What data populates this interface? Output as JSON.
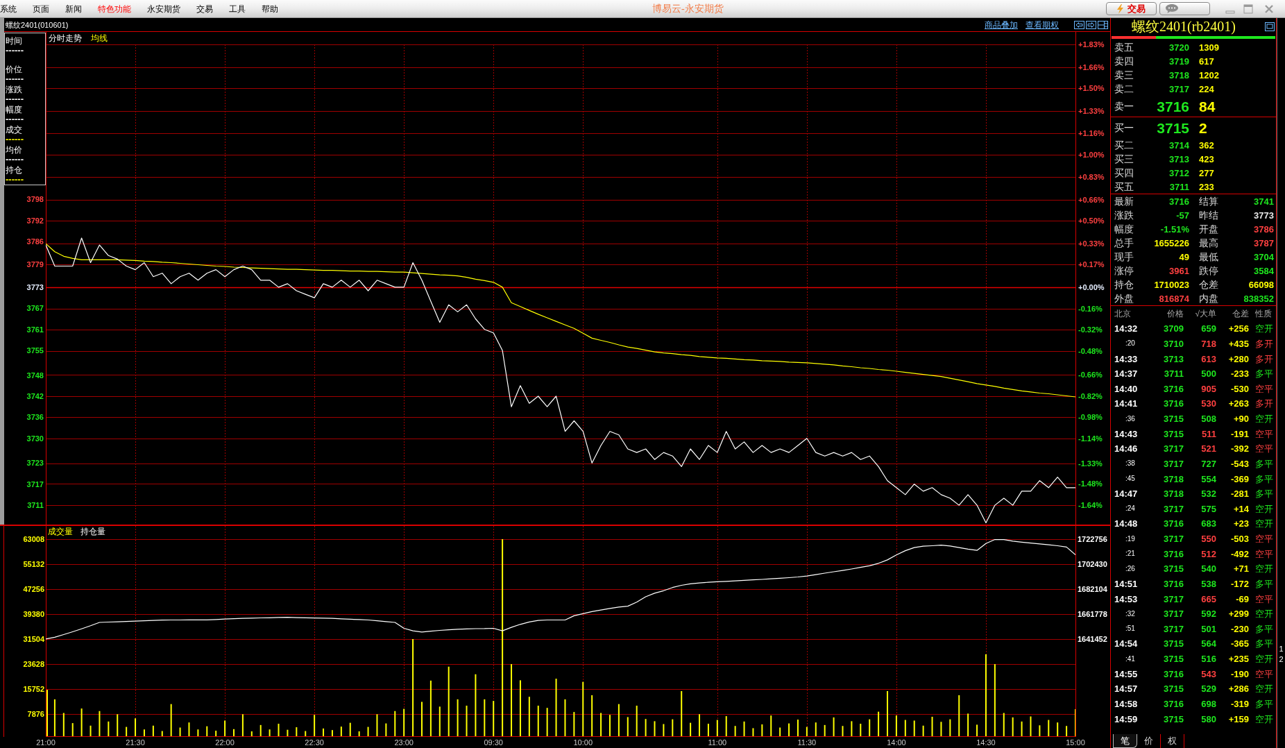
{
  "menu_bar": {
    "items": [
      {
        "label": "系统",
        "highlighted": false
      },
      {
        "label": "页面",
        "highlighted": false
      },
      {
        "label": "新闻",
        "highlighted": false
      },
      {
        "label": "特色功能",
        "highlighted": true
      },
      {
        "label": "永安期货",
        "highlighted": false
      },
      {
        "label": "交易",
        "highlighted": false
      },
      {
        "label": "工具",
        "highlighted": false
      },
      {
        "label": "帮助",
        "highlighted": false
      }
    ],
    "title": "博易云-永安期货",
    "trade_button": {
      "label": "交易"
    }
  },
  "contract_bar": {
    "title": "螺纹2401(010601)",
    "links": [
      "商品叠加",
      "查看期权"
    ]
  },
  "info_box": {
    "items": [
      {
        "label": "时间",
        "value": "------",
        "color": "#ffffff"
      },
      {
        "label": "价位",
        "value": "------",
        "color": "#ffffff"
      },
      {
        "label": "涨跌",
        "value": "------",
        "color": "#ffffff"
      },
      {
        "label": "幅度",
        "value": "------",
        "color": "#ffffff"
      },
      {
        "label": "成交",
        "value": "------",
        "color": "#ffff00"
      },
      {
        "label": "均价",
        "value": "------",
        "color": "#ffffff"
      },
      {
        "label": "持仓",
        "value": "------",
        "color": "#ffff00"
      }
    ]
  },
  "price_chart": {
    "chart_data": {
      "type": "line",
      "grid": true,
      "categories": [
        null,
        null,
        null,
        null,
        null,
        null,
        null,
        null,
        null,
        null,
        null,
        null,
        null,
        null,
        null,
        null,
        null,
        null,
        null,
        null,
        null,
        null,
        null,
        null,
        null,
        null,
        null,
        null,
        null,
        null,
        null,
        null,
        null,
        null,
        null,
        null,
        null,
        null,
        null,
        null,
        null,
        null,
        null,
        null,
        null,
        null,
        null,
        null,
        null,
        null,
        null,
        null,
        null,
        null,
        null,
        null,
        null,
        null,
        null,
        null,
        null,
        null,
        null,
        null,
        null,
        null,
        null,
        null,
        null,
        null,
        null,
        null,
        null,
        null,
        null,
        null,
        null,
        null,
        null,
        null,
        null,
        null,
        null,
        null,
        null,
        null,
        null,
        null,
        null,
        null,
        null,
        null,
        null,
        null,
        null,
        null,
        null,
        null,
        null,
        null,
        null,
        null,
        null,
        null,
        null,
        null,
        null,
        null,
        null,
        null,
        null,
        null,
        null,
        null,
        null,
        null
      ],
      "ylim": [
        3705.5,
        3842.05
      ],
      "y2lim": [
        -1.789,
        1.83
      ],
      "ref_lines": [
        {
          "axis": "y",
          "value": 3773
        }
      ],
      "yticks": [
        3798,
        3792,
        3786,
        {
          "value": 3779.4,
          "label": "3779"
        },
        3773,
        3767,
        3761,
        3755,
        3748,
        3742,
        3736,
        3730,
        3723,
        3717,
        3711
      ],
      "y2ticks": [
        {
          "value": 1.83,
          "label": "+1.83%"
        },
        {
          "value": 1.66,
          "label": "+1.66%"
        },
        {
          "value": 1.5,
          "label": "+1.50%"
        },
        {
          "value": 1.33,
          "label": "+1.33%"
        },
        {
          "value": 1.16,
          "label": "+1.16%"
        },
        {
          "value": 1.0,
          "label": "+1.00%"
        },
        {
          "value": 0.83,
          "label": "+0.83%"
        },
        {
          "value": 0.66,
          "label": "+0.66%"
        },
        {
          "value": 0.5,
          "label": "+0.50%"
        },
        {
          "value": 0.33,
          "label": "+0.33%"
        },
        {
          "value": 0.17,
          "label": "+0.17%"
        },
        {
          "value": 0,
          "label": "+0.00%"
        },
        {
          "value": -0.16,
          "label": "-0.16%"
        },
        {
          "value": -0.32,
          "label": "-0.32%"
        },
        {
          "value": -0.48,
          "label": "-0.48%"
        },
        {
          "value": -0.66,
          "label": "-0.66%"
        },
        {
          "value": -0.82,
          "label": "-0.82%"
        },
        {
          "value": -0.98,
          "label": "-0.98%"
        },
        {
          "value": -1.14,
          "label": "-1.14%"
        },
        {
          "value": -1.33,
          "label": "-1.33%"
        },
        {
          "value": -1.48,
          "label": "-1.48%"
        },
        {
          "value": -1.64,
          "label": "-1.64%"
        }
      ],
      "series": [
        {
          "name": "分时走势",
          "color": "#ffffff",
          "values": [
            3785,
            3779,
            3779,
            3779,
            3787,
            3780,
            3785,
            3782,
            3781,
            3779,
            3778,
            3780,
            3776,
            3777,
            3774,
            3776,
            3777,
            3775,
            3777,
            3778,
            3776,
            3778,
            3779,
            3778,
            3775,
            3775,
            3773,
            3774,
            3772,
            3771,
            3770,
            3774,
            3773,
            3775,
            3773,
            3775,
            3772,
            3775,
            3774,
            3773,
            3773,
            3780,
            3775,
            3769,
            3763,
            3768,
            3766,
            3768,
            3764,
            3761,
            3760,
            3755,
            3739,
            3745,
            3740,
            3742,
            3739,
            3742,
            3732,
            3735,
            3732,
            3723,
            3728,
            3732,
            3731,
            3727,
            3726,
            3727,
            3724,
            3726,
            3725,
            3722,
            3727,
            3724,
            3728,
            3726,
            3732,
            3727,
            3729,
            3726,
            3728,
            3726,
            3727,
            3726,
            3728,
            3730,
            3726,
            3725,
            3726,
            3725,
            3726,
            3724,
            3725,
            3722,
            3718,
            3716,
            3714,
            3717,
            3715,
            3716,
            3714,
            3713,
            3711,
            3714,
            3711,
            3706,
            3711,
            3713,
            3711,
            3715,
            3715,
            3718,
            3716,
            3719,
            3716,
            3716
          ]
        },
        {
          "name": "均线",
          "color": "#ffff00",
          "values": [
            3785.4,
            3783.1,
            3781.8,
            3781.2,
            3780.8,
            3780.8,
            3780.8,
            3780.8,
            3780.8,
            3780.7,
            3780.6,
            3780.4,
            3780.3,
            3780.1,
            3780.0,
            3779.8,
            3779.6,
            3779.4,
            3779.2,
            3779.0,
            3778.9,
            3778.7,
            3778.6,
            3778.5,
            3778.4,
            3778.3,
            3778.2,
            3778.1,
            3778.1,
            3778.0,
            3777.9,
            3777.8,
            3777.8,
            3777.7,
            3777.6,
            3777.6,
            3777.5,
            3777.5,
            3777.4,
            3777.3,
            3777.3,
            3777.1,
            3776.9,
            3776.7,
            3776.5,
            3776.4,
            3776.2,
            3775.8,
            3775.3,
            3774.9,
            3774.4,
            3773.0,
            3768.6,
            3767.5,
            3766.4,
            3765.3,
            3764.3,
            3763.3,
            3762.3,
            3761.3,
            3759.9,
            3758.5,
            3757.9,
            3757.3,
            3756.6,
            3756.0,
            3755.6,
            3755.1,
            3754.6,
            3754.3,
            3754.1,
            3753.8,
            3753.6,
            3753.3,
            3753.1,
            3752.9,
            3752.8,
            3752.6,
            3752.4,
            3752.3,
            3752.1,
            3752.0,
            3751.9,
            3751.7,
            3751.6,
            3751.5,
            3751.3,
            3751.1,
            3750.9,
            3750.6,
            3750.4,
            3750.1,
            3749.9,
            3749.6,
            3749.4,
            3749.1,
            3748.8,
            3748.5,
            3748.2,
            3747.9,
            3747.6,
            3747.1,
            3746.6,
            3746.1,
            3745.6,
            3745.2,
            3744.8,
            3744.3,
            3743.9,
            3743.5,
            3743.2,
            3742.9,
            3742.7,
            3742.4,
            3742.1,
            3741.8
          ]
        }
      ]
    }
  },
  "volume_chart": {
    "chart_data": {
      "type": "bar",
      "grid": true,
      "categories": [
        "21:00",
        null,
        null,
        null,
        null,
        null,
        null,
        null,
        null,
        null,
        "21:30",
        null,
        null,
        null,
        null,
        null,
        null,
        null,
        null,
        null,
        "22:00",
        null,
        null,
        null,
        null,
        null,
        null,
        null,
        null,
        null,
        "22:30",
        null,
        null,
        null,
        null,
        null,
        null,
        null,
        null,
        null,
        "23:00",
        null,
        null,
        null,
        null,
        null,
        null,
        null,
        null,
        null,
        "09:30",
        null,
        null,
        null,
        null,
        null,
        null,
        null,
        null,
        null,
        "10:00",
        null,
        null,
        null,
        null,
        null,
        null,
        null,
        null,
        null,
        null,
        null,
        null,
        null,
        null,
        "11:00",
        null,
        null,
        null,
        null,
        null,
        null,
        null,
        null,
        null,
        "11:30",
        null,
        null,
        null,
        null,
        null,
        null,
        null,
        null,
        null,
        "14:00",
        null,
        null,
        null,
        null,
        null,
        null,
        null,
        null,
        null,
        "14:30",
        null,
        null,
        null,
        null,
        null,
        null,
        null,
        null,
        null,
        "15:00"
      ],
      "ylim": [
        650,
        67160
      ],
      "yticks": [
        63008,
        55132,
        47256,
        39380,
        31504,
        23628,
        15752,
        7876
      ],
      "series": [
        {
          "name": "成交量",
          "color": "#ffff00",
          "values": [
            15500,
            12500,
            8200,
            5000,
            9600,
            4200,
            8800,
            5500,
            7800,
            3800,
            6500,
            3000,
            4200,
            2500,
            11000,
            3600,
            5200,
            3000,
            4000,
            2600,
            5800,
            3100,
            7800,
            2400,
            4400,
            3000,
            4800,
            2900,
            3700,
            2500,
            7600,
            3300,
            2800,
            3900,
            5100,
            2400,
            3800,
            7800,
            4900,
            8800,
            9500,
            31500,
            11700,
            18400,
            10200,
            22800,
            12500,
            10500,
            20400,
            12500,
            12000,
            63000,
            23600,
            18500,
            13300,
            10500,
            9800,
            19000,
            12500,
            8500,
            18000,
            13800,
            8200,
            7600,
            11000,
            6900,
            10500,
            6300,
            5600,
            4700,
            6200,
            15100,
            5100,
            7800,
            4800,
            6000,
            7200,
            4100,
            5500,
            3400,
            4600,
            7400,
            3600,
            4900,
            6100,
            3800,
            5200,
            4400,
            6800,
            4100,
            5600,
            4800,
            6200,
            8600,
            15100,
            7400,
            6000,
            5800,
            4200,
            7000,
            5400,
            6200,
            13800,
            8000,
            4500,
            26700,
            23600,
            8200,
            6800,
            5500,
            7100,
            4300,
            6000,
            5200,
            4100,
            9400
          ]
        }
      ]
    }
  },
  "open_interest_chart": {
    "chart_data": {
      "type": "line",
      "categories": [
        null,
        null,
        null,
        null,
        null,
        null,
        null,
        null,
        null,
        null,
        null,
        null,
        null,
        null,
        null,
        null,
        null,
        null,
        null,
        null,
        null,
        null,
        null,
        null,
        null,
        null,
        null,
        null,
        null,
        null,
        null,
        null,
        null,
        null,
        null,
        null,
        null,
        null,
        null,
        null,
        null,
        null,
        null,
        null,
        null,
        null,
        null,
        null,
        null,
        null,
        null,
        null,
        null,
        null,
        null,
        null,
        null,
        null,
        null,
        null,
        null,
        null,
        null,
        null,
        null,
        null,
        null,
        null,
        null,
        null,
        null,
        null,
        null,
        null,
        null,
        null,
        null,
        null,
        null,
        null,
        null,
        null,
        null,
        null,
        null,
        null,
        null,
        null,
        null,
        null,
        null,
        null,
        null,
        null,
        null,
        null,
        null,
        null,
        null,
        null,
        null,
        null,
        null,
        null,
        null,
        null,
        null,
        null,
        null,
        null,
        null,
        null,
        null,
        null,
        null,
        null
      ],
      "ylim": [
        1561845,
        1733483
      ],
      "yticks": [
        1722756,
        1702430,
        1682104,
        1661778,
        1641452
      ],
      "series": [
        {
          "name": "持仓量",
          "color": "#ffffff",
          "values": [
            1641500,
            1643000,
            1645100,
            1647400,
            1649800,
            1652300,
            1655000,
            1655300,
            1655500,
            1655800,
            1656100,
            1656300,
            1656600,
            1656900,
            1657000,
            1657000,
            1657100,
            1657100,
            1657100,
            1657400,
            1657700,
            1658000,
            1658300,
            1658500,
            1658700,
            1658800,
            1659000,
            1659100,
            1658900,
            1658800,
            1658600,
            1658500,
            1658300,
            1657900,
            1657600,
            1657300,
            1657000,
            1656300,
            1655700,
            1655000,
            1650200,
            1648200,
            1647200,
            1647900,
            1648500,
            1649000,
            1649400,
            1649700,
            1649900,
            1650000,
            1650200,
            1648200,
            1651000,
            1653400,
            1655400,
            1656600,
            1657000,
            1657000,
            1657000,
            1660400,
            1662100,
            1663800,
            1665100,
            1666400,
            1667500,
            1668200,
            1671500,
            1675900,
            1678800,
            1680800,
            1683400,
            1685200,
            1686400,
            1687100,
            1687700,
            1688100,
            1688400,
            1688800,
            1689200,
            1689600,
            1690000,
            1690500,
            1690900,
            1691400,
            1692000,
            1692700,
            1693900,
            1695100,
            1696200,
            1697300,
            1698500,
            1699800,
            1701100,
            1703100,
            1705900,
            1709900,
            1713400,
            1715900,
            1717000,
            1717400,
            1717900,
            1717200,
            1715900,
            1714600,
            1713600,
            1719200,
            1722500,
            1722400,
            1721200,
            1720300,
            1719600,
            1718900,
            1718200,
            1717400,
            1716300,
            1710000
          ]
        }
      ]
    }
  },
  "quote_panel": {
    "title": "螺纹2401(rb2401)",
    "ratio_bar": {
      "level": 0.27
    },
    "asks": [
      {
        "label": "卖五",
        "price": "3720",
        "volume": "1309",
        "kind": "level"
      },
      {
        "label": "卖四",
        "price": "3719",
        "volume": "617",
        "kind": "level"
      },
      {
        "label": "卖三",
        "price": "3718",
        "volume": "1202",
        "kind": "level"
      },
      {
        "label": "卖二",
        "price": "3717",
        "volume": "224",
        "kind": "level"
      },
      {
        "label": "卖一",
        "price": "3716",
        "volume": "84",
        "kind": "best"
      }
    ],
    "bids": [
      {
        "label": "买一",
        "price": "3715",
        "volume": "2",
        "kind": "best"
      },
      {
        "label": "买二",
        "price": "3714",
        "volume": "362",
        "kind": "level"
      },
      {
        "label": "买三",
        "price": "3713",
        "volume": "423",
        "kind": "level"
      },
      {
        "label": "买四",
        "price": "3712",
        "volume": "277",
        "kind": "level"
      },
      {
        "label": "买五",
        "price": "3711",
        "volume": "233",
        "kind": "level"
      }
    ],
    "stats": [
      {
        "label": "最新",
        "value": "3716",
        "color": "#1ee81e"
      },
      {
        "label": "结算",
        "value": "3741",
        "color": "#1ee81e"
      },
      {
        "label": "涨跌",
        "value": "-57",
        "color": "#1ee81e"
      },
      {
        "label": "昨结",
        "value": "3773",
        "color": "#e8e8e8"
      },
      {
        "label": "幅度",
        "value": "-1.51%",
        "color": "#1ee81e"
      },
      {
        "label": "开盘",
        "value": "3786",
        "color": "#ff4040"
      },
      {
        "label": "总手",
        "value": "1655226",
        "color": "#ffff00"
      },
      {
        "label": "最高",
        "value": "3787",
        "color": "#ff4040"
      },
      {
        "label": "现手",
        "value": "49",
        "color": "#ffff00"
      },
      {
        "label": "最低",
        "value": "3704",
        "color": "#1ee81e"
      },
      {
        "label": "涨停",
        "value": "3961",
        "color": "#ff4040"
      },
      {
        "label": "跌停",
        "value": "3584",
        "color": "#1ee81e"
      },
      {
        "label": "持仓",
        "value": "1710023",
        "color": "#ffff00"
      },
      {
        "label": "仓差",
        "value": "66098",
        "color": "#ffff00"
      },
      {
        "label": "外盘",
        "value": "816874",
        "color": "#ff4040"
      },
      {
        "label": "内盘",
        "value": "838352",
        "color": "#1ee81e"
      }
    ],
    "trade_columns": [
      "北京",
      "价格",
      "√大单",
      "仓差",
      "性质"
    ],
    "trades": [
      {
        "time": "14:32",
        "kind": "minute",
        "price": "3709",
        "volume": "659",
        "change": "+256",
        "nature": "空开",
        "color": "#1ee81e"
      },
      {
        "time": ":20",
        "kind": "second",
        "price": "3710",
        "volume": "718",
        "change": "+435",
        "nature": "多开",
        "color": "#ff4040"
      },
      {
        "time": "14:33",
        "kind": "minute",
        "price": "3713",
        "volume": "613",
        "change": "+280",
        "nature": "多开",
        "color": "#ff4040"
      },
      {
        "time": "14:37",
        "kind": "minute",
        "price": "3711",
        "volume": "500",
        "change": "-233",
        "nature": "多平",
        "color": "#1ee81e"
      },
      {
        "time": "14:40",
        "kind": "minute",
        "price": "3716",
        "volume": "905",
        "change": "-530",
        "nature": "空平",
        "color": "#ff4040"
      },
      {
        "time": "14:41",
        "kind": "minute",
        "price": "3716",
        "volume": "530",
        "change": "+263",
        "nature": "多开",
        "color": "#ff4040"
      },
      {
        "time": ":36",
        "kind": "second",
        "price": "3715",
        "volume": "508",
        "change": "+90",
        "nature": "空开",
        "color": "#1ee81e"
      },
      {
        "time": "14:43",
        "kind": "minute",
        "price": "3715",
        "volume": "511",
        "change": "-191",
        "nature": "空平",
        "color": "#ff4040"
      },
      {
        "time": "14:46",
        "kind": "minute",
        "price": "3717",
        "volume": "521",
        "change": "-392",
        "nature": "空平",
        "color": "#ff4040"
      },
      {
        "time": ":38",
        "kind": "second",
        "price": "3717",
        "volume": "727",
        "change": "-543",
        "nature": "多平",
        "color": "#1ee81e"
      },
      {
        "time": ":45",
        "kind": "second",
        "price": "3718",
        "volume": "554",
        "change": "-369",
        "nature": "多平",
        "color": "#1ee81e"
      },
      {
        "time": "14:47",
        "kind": "minute",
        "price": "3718",
        "volume": "532",
        "change": "-281",
        "nature": "多平",
        "color": "#1ee81e"
      },
      {
        "time": ":24",
        "kind": "second",
        "price": "3717",
        "volume": "575",
        "change": "+14",
        "nature": "空开",
        "color": "#1ee81e"
      },
      {
        "time": "14:48",
        "kind": "minute",
        "price": "3716",
        "volume": "683",
        "change": "+23",
        "nature": "空开",
        "color": "#1ee81e"
      },
      {
        "time": ":19",
        "kind": "second",
        "price": "3717",
        "volume": "550",
        "change": "-503",
        "nature": "空平",
        "color": "#ff4040"
      },
      {
        "time": ":21",
        "kind": "second",
        "price": "3716",
        "volume": "512",
        "change": "-492",
        "nature": "空平",
        "color": "#ff4040"
      },
      {
        "time": ":26",
        "kind": "second",
        "price": "3715",
        "volume": "540",
        "change": "+71",
        "nature": "空开",
        "color": "#1ee81e"
      },
      {
        "time": "14:51",
        "kind": "minute",
        "price": "3716",
        "volume": "538",
        "change": "-172",
        "nature": "多平",
        "color": "#1ee81e"
      },
      {
        "time": "14:53",
        "kind": "minute",
        "price": "3717",
        "volume": "665",
        "change": "-69",
        "nature": "空平",
        "color": "#ff4040"
      },
      {
        "time": ":32",
        "kind": "second",
        "price": "3717",
        "volume": "592",
        "change": "+299",
        "nature": "空开",
        "color": "#1ee81e"
      },
      {
        "time": ":51",
        "kind": "second",
        "price": "3717",
        "volume": "501",
        "change": "-230",
        "nature": "多平",
        "color": "#1ee81e"
      },
      {
        "time": "14:54",
        "kind": "minute",
        "price": "3715",
        "volume": "564",
        "change": "-365",
        "nature": "多平",
        "color": "#1ee81e"
      },
      {
        "time": ":41",
        "kind": "second",
        "price": "3715",
        "volume": "516",
        "change": "+235",
        "nature": "空开",
        "color": "#1ee81e"
      },
      {
        "time": "14:55",
        "kind": "minute",
        "price": "3716",
        "volume": "543",
        "change": "-190",
        "nature": "空平",
        "color": "#ff4040"
      },
      {
        "time": "14:57",
        "kind": "minute",
        "price": "3715",
        "volume": "529",
        "change": "+286",
        "nature": "空开",
        "color": "#1ee81e"
      },
      {
        "time": "14:58",
        "kind": "minute",
        "price": "3716",
        "volume": "698",
        "change": "-319",
        "nature": "多平",
        "color": "#1ee81e"
      },
      {
        "time": "14:59",
        "kind": "minute",
        "price": "3715",
        "volume": "580",
        "change": "+159",
        "nature": "空开",
        "color": "#1ee81e"
      }
    ],
    "tabs": [
      {
        "label": "笔",
        "selected": true
      },
      {
        "label": "价",
        "selected": false
      },
      {
        "label": "权",
        "selected": false
      }
    ]
  },
  "edge_strip": {
    "labels": [
      "1",
      "2"
    ]
  }
}
